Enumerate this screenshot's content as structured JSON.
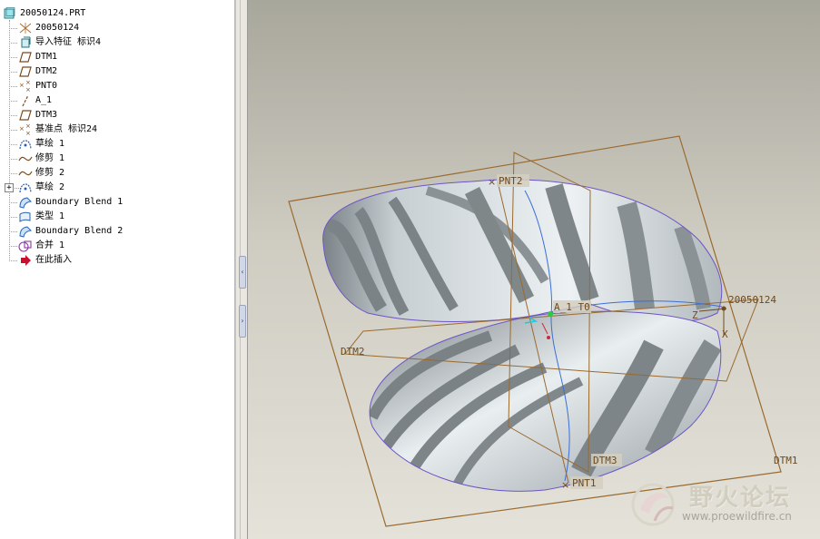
{
  "model_tree": {
    "root": "20050124.PRT",
    "items": [
      {
        "label": "20050124",
        "icon": "csys-icon"
      },
      {
        "label": "导入特征 标识4",
        "icon": "import-feature-icon"
      },
      {
        "label": "DTM1",
        "icon": "datum-plane-icon"
      },
      {
        "label": "DTM2",
        "icon": "datum-plane-icon"
      },
      {
        "label": "PNT0",
        "icon": "datum-point-icon"
      },
      {
        "label": "A_1",
        "icon": "datum-axis-icon"
      },
      {
        "label": "DTM3",
        "icon": "datum-plane-icon"
      },
      {
        "label": "基准点 标识24",
        "icon": "datum-point-icon"
      },
      {
        "label": "草绘 1",
        "icon": "sketch-icon"
      },
      {
        "label": "修剪 1",
        "icon": "trim-icon"
      },
      {
        "label": "修剪 2",
        "icon": "trim-icon"
      },
      {
        "label": "草绘 2",
        "icon": "sketch-icon"
      },
      {
        "label": "Boundary Blend 1",
        "icon": "boundary-blend-icon"
      },
      {
        "label": "类型 1",
        "icon": "surface-icon"
      },
      {
        "label": "Boundary Blend 2",
        "icon": "boundary-blend-icon"
      },
      {
        "label": "合并 1",
        "icon": "merge-icon"
      },
      {
        "label": "在此插入",
        "icon": "insert-here-arrow-icon"
      }
    ],
    "expander_symbol": "+"
  },
  "viewport": {
    "labels": {
      "pnt2": "PNT2",
      "pnt1": "PNT1",
      "a1_pnt0": "A_1 T0",
      "csys": "20050124",
      "dtm1": "DTM1",
      "dtm2": "DTM2",
      "dtm3": "DTM3",
      "axis_z": "Z",
      "axis_x": "X"
    },
    "colors": {
      "datum": "#9a6a2e",
      "curve": "#3a6ed8",
      "surface_light": "#e7ecef",
      "surface_dark": "#7d8588"
    }
  },
  "watermark": {
    "title": "野火论坛",
    "url": "www.proewildfire.cn"
  }
}
